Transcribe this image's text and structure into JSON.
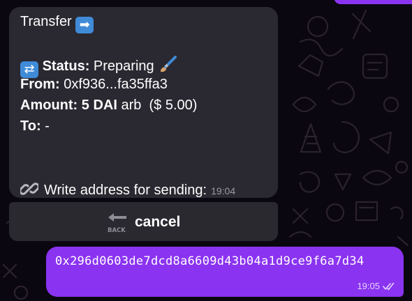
{
  "bot_message": {
    "title": "Transfer",
    "title_emoji": "➡",
    "status_emoji": "⇄",
    "status_label": "Status",
    "status_value": "Preparing",
    "from_label": "From:",
    "from_value": "0xf936...fa35ffa3",
    "amount_label": "Amount:",
    "amount_value": "5 DAI",
    "amount_chain": "arb",
    "amount_usd": "($ 5.00)",
    "to_label": "To:",
    "to_value": "-",
    "prompt_text": "Write address for sending:",
    "time": "19:04"
  },
  "keyboard": {
    "cancel_label": "cancel",
    "back_icon_text": "BACK"
  },
  "user_message": {
    "text": "0x296d0603de7dcd8a6609d43b04a1d9ce9f6a7d34",
    "time": "19:05"
  },
  "colors": {
    "background": "#0b0710",
    "bot_bubble": "#2a2830",
    "user_bubble": "#8a33f0",
    "emoji_blue": "#3f8bd8"
  }
}
